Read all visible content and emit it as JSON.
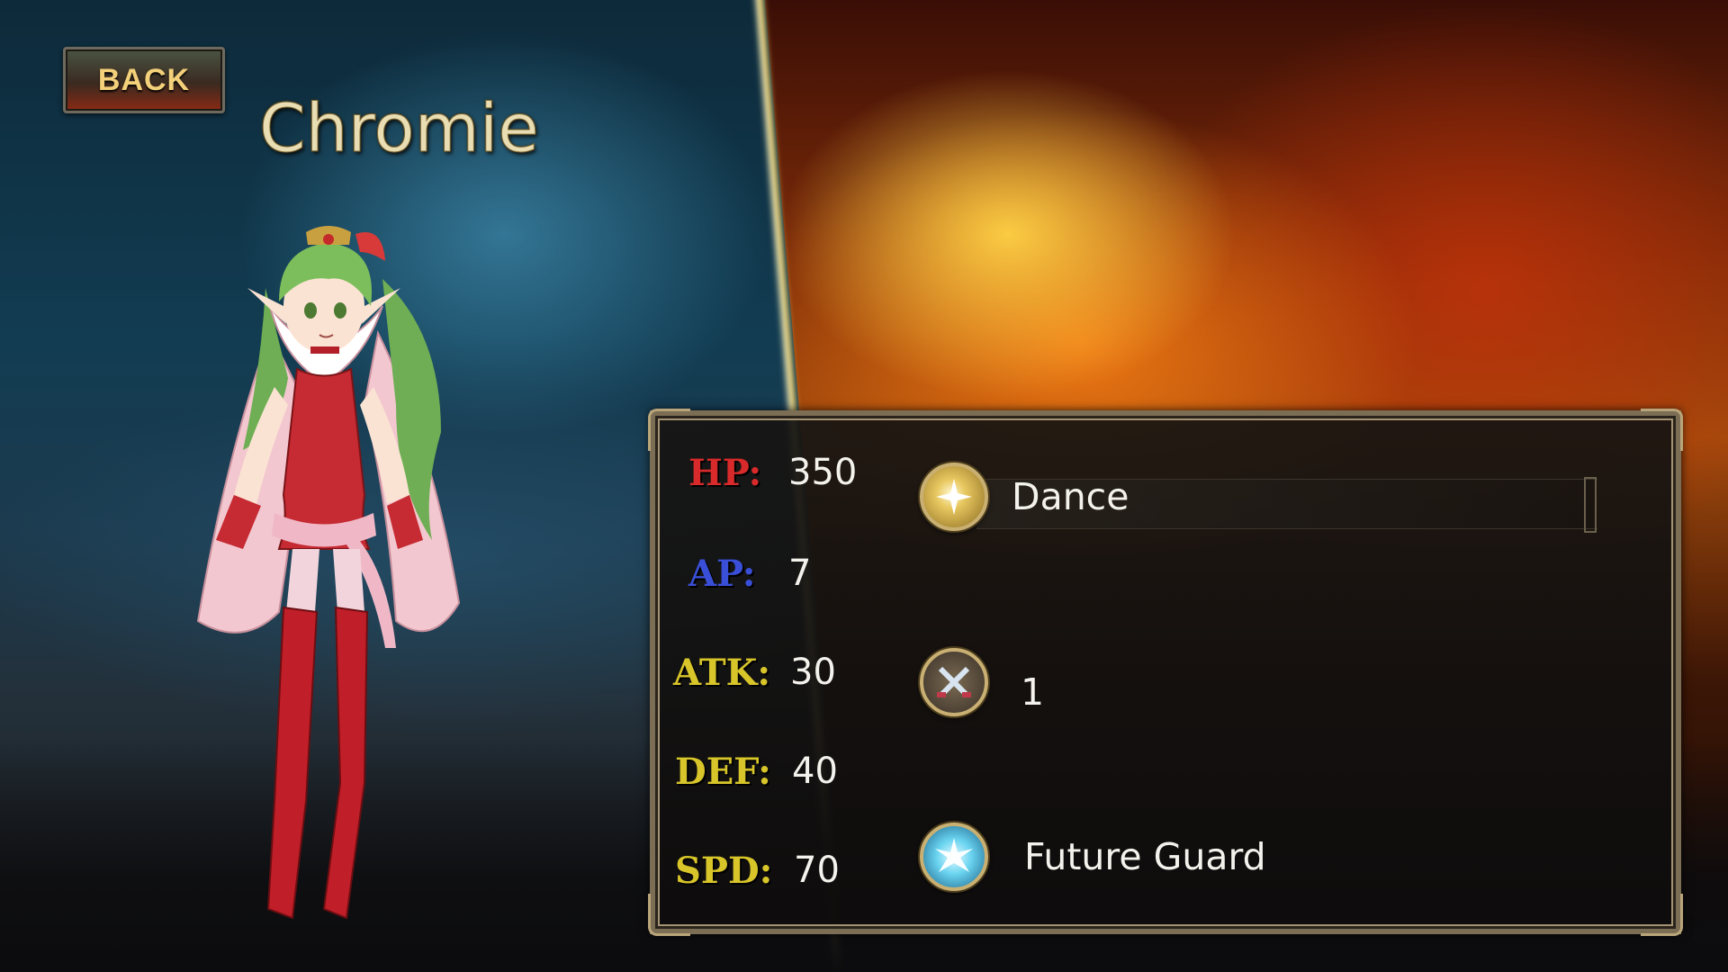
{
  "header": {
    "back_label": "BACK",
    "character_name": "Chromie"
  },
  "stats": [
    {
      "label": "HP:",
      "value": "350",
      "color": "#d82a2a"
    },
    {
      "label": "AP:",
      "value": "7",
      "color": "#3a4fd8"
    },
    {
      "label": "ATK:",
      "value": "30",
      "color": "#d8c52a"
    },
    {
      "label": "DEF:",
      "value": "40",
      "color": "#d8c52a"
    },
    {
      "label": "SPD:",
      "value": "70",
      "color": "#d8c52a"
    }
  ],
  "skills": [
    {
      "name": "Dance",
      "icon": "starburst-icon"
    },
    {
      "name": "1",
      "icon": "crossed-swords-icon"
    },
    {
      "name": "Future Guard",
      "icon": "crystal-burst-icon"
    }
  ],
  "colors": {
    "panel_border": "#7b6e55",
    "name_gold": "#e9ddb3",
    "back_text": "#f3d07a"
  }
}
